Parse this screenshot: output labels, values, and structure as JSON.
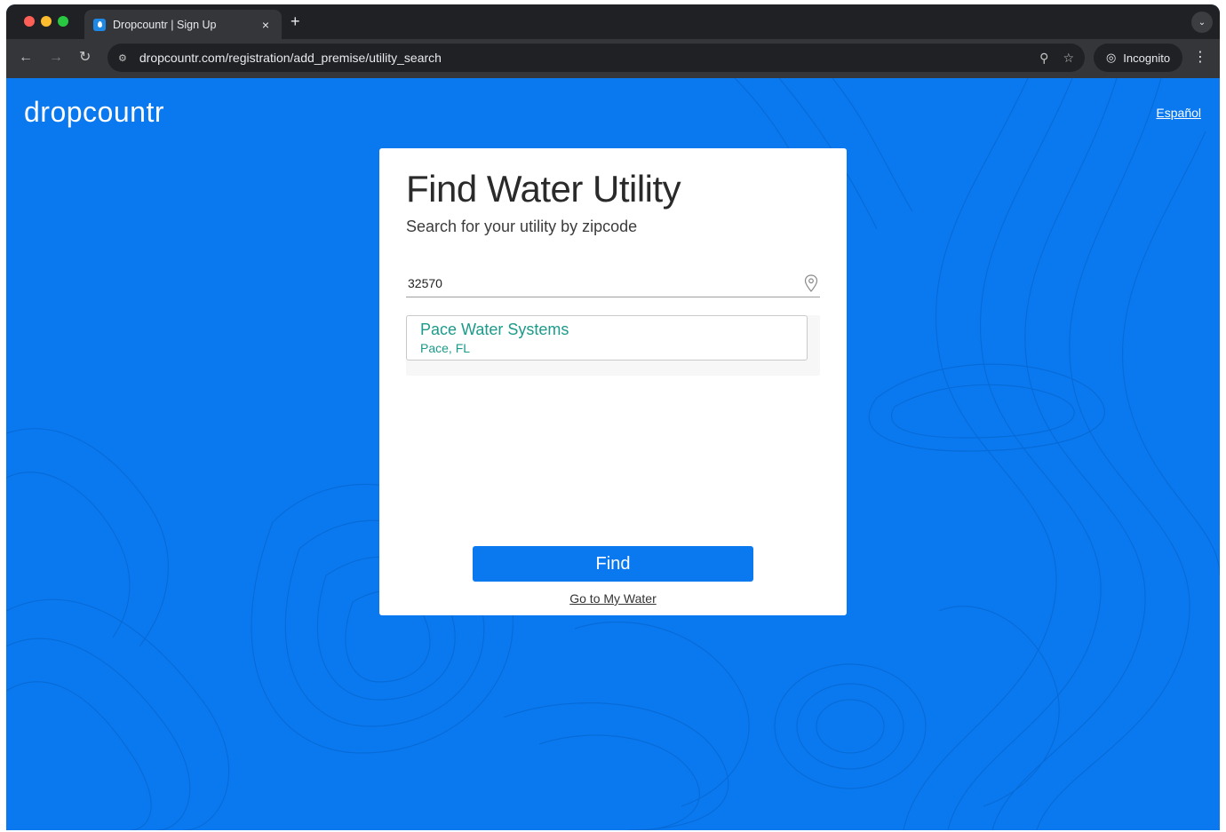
{
  "browser": {
    "tab_title": "Dropcountr | Sign Up",
    "tab_close": "×",
    "new_tab": "+",
    "tab_menu": "⌄",
    "url": "dropcountr.com/registration/add_premise/utility_search",
    "incognito_label": "Incognito",
    "back": "←",
    "forward": "→",
    "reload": "↻",
    "zoom": "⚲",
    "star": "☆",
    "menu": "⋮"
  },
  "header": {
    "logo": "dropcountr",
    "language_link": "Español"
  },
  "card": {
    "title": "Find Water Utility",
    "subtitle": "Search for your utility by zipcode",
    "zip_value": "32570",
    "results": [
      {
        "name": "Pace Water Systems",
        "location": "Pace, FL"
      }
    ],
    "find_label": "Find",
    "my_water_link": "Go to My Water"
  },
  "colors": {
    "brand_blue": "#0a79f0",
    "result_teal": "#1c9a8a"
  }
}
